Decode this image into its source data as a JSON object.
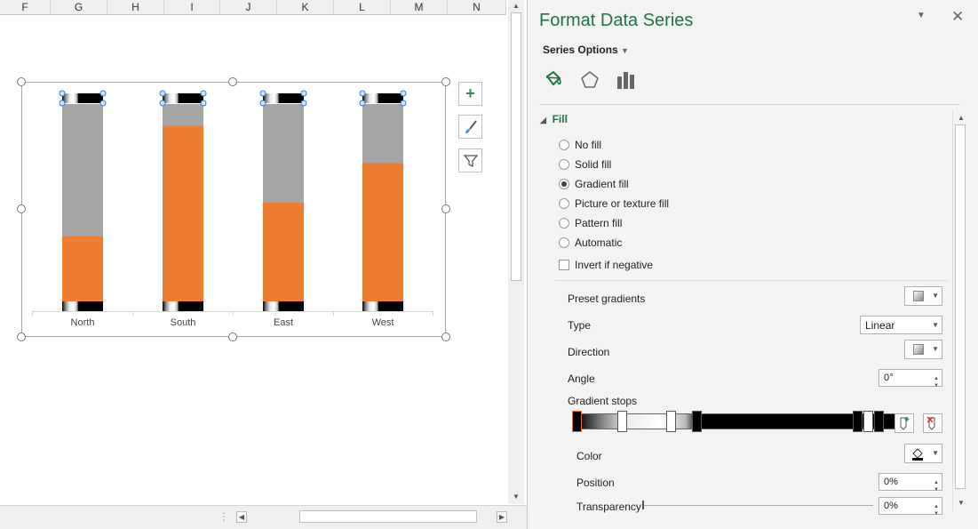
{
  "sheet": {
    "columns": [
      "F",
      "G",
      "H",
      "I",
      "J",
      "K",
      "L",
      "M",
      "N"
    ]
  },
  "chart": {
    "categories": [
      "North",
      "South",
      "East",
      "West"
    ],
    "colors": {
      "fill": "#ed7d31",
      "background": "#a5a5a5"
    }
  },
  "chart_data": {
    "type": "bar",
    "categories": [
      "North",
      "South",
      "East",
      "West"
    ],
    "series": [
      {
        "values": [
          0.33,
          0.89,
          0.5,
          0.7
        ]
      }
    ],
    "ylim": [
      0,
      1
    ]
  },
  "pane": {
    "title": "Format Data Series",
    "series_options": "Series Options",
    "close": "✕",
    "tabs": [
      "fill-line-icon",
      "effects-icon",
      "series-options-icon"
    ],
    "section": "Fill",
    "fill_options": [
      {
        "label": "No fill",
        "checked": false
      },
      {
        "label": "Solid fill",
        "checked": false
      },
      {
        "label": "Gradient fill",
        "checked": true
      },
      {
        "label": "Picture or texture fill",
        "checked": false
      },
      {
        "label": "Pattern fill",
        "checked": false
      },
      {
        "label": "Automatic",
        "checked": false
      }
    ],
    "invert_label": "Invert if negative",
    "preset_label": "Preset gradients",
    "type_label": "Type",
    "type_value": "Linear",
    "direction_label": "Direction",
    "angle_label": "Angle",
    "angle_value": "0°",
    "stops_label": "Gradient stops",
    "color_label": "Color",
    "position_label": "Position",
    "position_value": "0%",
    "transparency_label": "Transparency",
    "transparency_value": "0%"
  }
}
